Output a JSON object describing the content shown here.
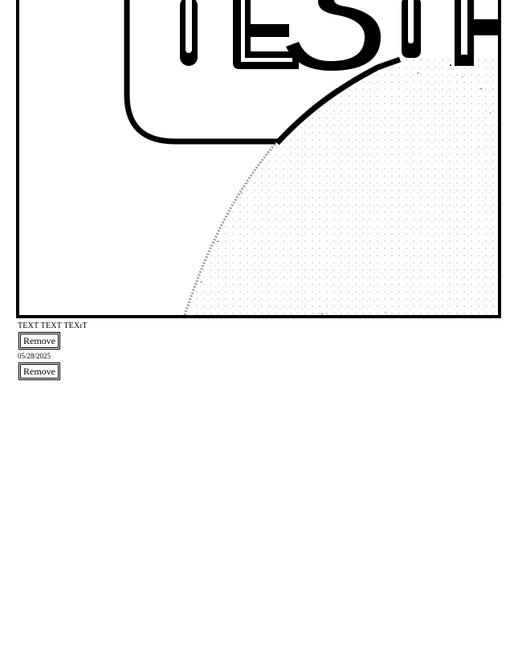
{
  "image": {
    "name": "test-image",
    "headline_text": "TEST",
    "colors": {
      "ink": "#000000",
      "paper": "#ffffff",
      "speckle": "#9a9a9a"
    }
  },
  "items": [
    {
      "caption": "TEXT TEXT TEXıT",
      "action_label": "Remove"
    },
    {
      "caption": "05/28/2025",
      "action_label": "Remove"
    }
  ]
}
